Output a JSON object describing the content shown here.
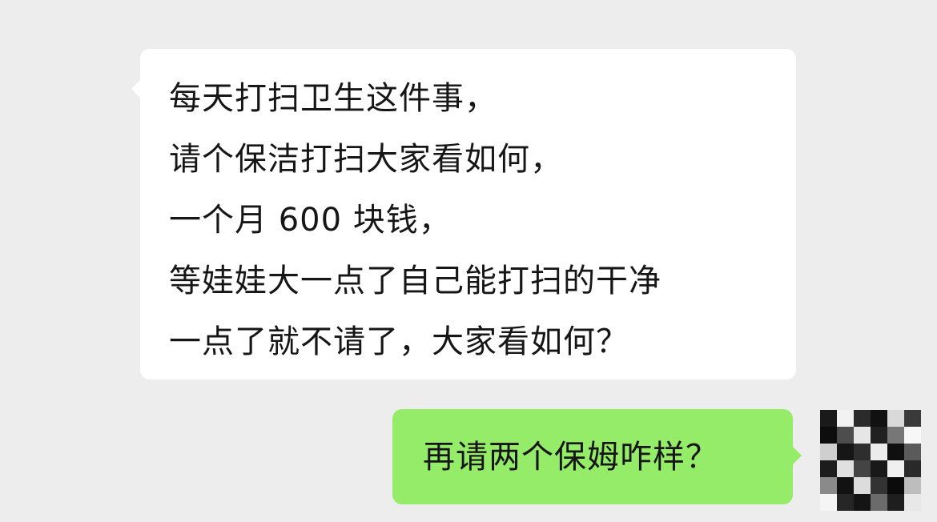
{
  "chat": {
    "incoming": {
      "lines": [
        "每天打扫卫生这件事，",
        "请个保洁打扫大家看如何，",
        "一个月 600 块钱，",
        "等娃娃大一点了自己能打扫的干净",
        "一点了就不请了，大家看如何？"
      ]
    },
    "outgoing": {
      "text": "再请两个保姆咋样？"
    }
  },
  "colors": {
    "background": "#ededed",
    "incoming_bubble": "#ffffff",
    "outgoing_bubble": "#95ec69"
  },
  "avatar": {
    "description_icon": "pixelated-avatar-icon"
  }
}
